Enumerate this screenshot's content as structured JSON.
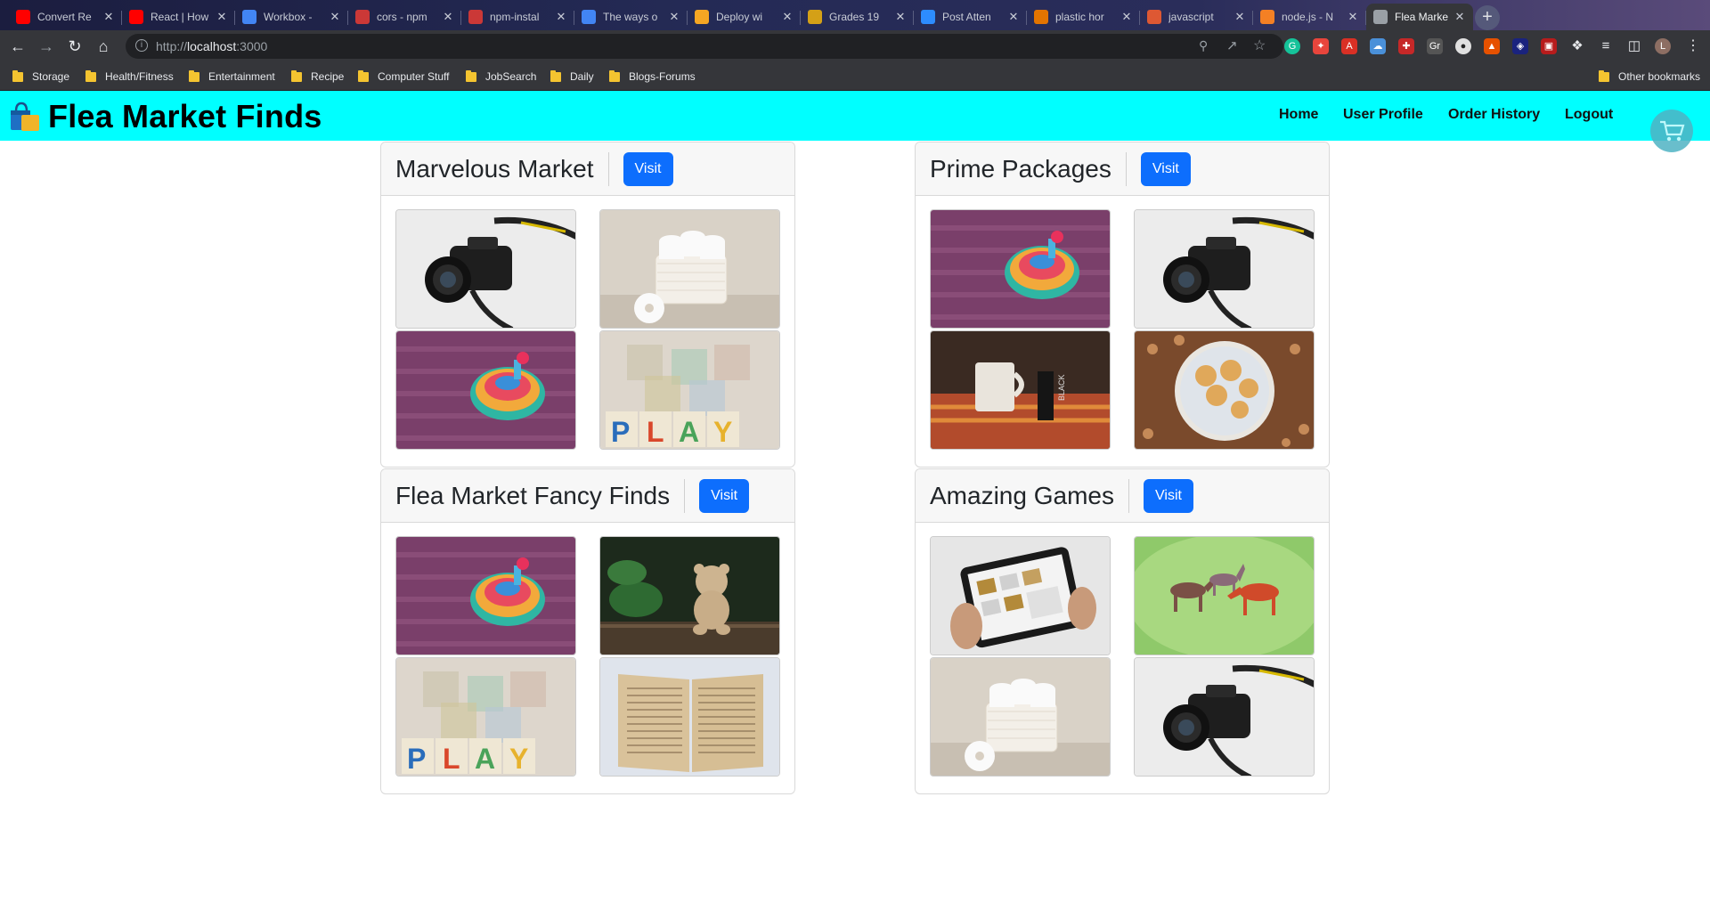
{
  "browser": {
    "tabs": [
      {
        "title": "Convert Re",
        "icon": "youtube-icon",
        "color": "#ff0000"
      },
      {
        "title": "React | How",
        "icon": "youtube-icon",
        "color": "#ff0000"
      },
      {
        "title": "Workbox - ",
        "icon": "chrome-icon",
        "color": "#4285f4"
      },
      {
        "title": "cors - npm",
        "icon": "npm-icon",
        "color": "#cb3837"
      },
      {
        "title": "npm-instal",
        "icon": "npm-icon",
        "color": "#cb3837"
      },
      {
        "title": "The ways o",
        "icon": "chrome-icon",
        "color": "#4285f4"
      },
      {
        "title": "Deploy wi",
        "icon": "deploy-icon",
        "color": "#f5a623"
      },
      {
        "title": "Grades 19",
        "icon": "bee-icon",
        "color": "#d4a017"
      },
      {
        "title": "Post Atten",
        "icon": "zoom-icon",
        "color": "#2d8cff"
      },
      {
        "title": "plastic hor",
        "icon": "chart-icon",
        "color": "#e37400"
      },
      {
        "title": "javascript ",
        "icon": "duck-icon",
        "color": "#de5833"
      },
      {
        "title": "node.js - N",
        "icon": "stack-icon",
        "color": "#f48024"
      },
      {
        "title": "Flea Marke",
        "icon": "globe-icon",
        "color": "#9aa0a6"
      }
    ],
    "url_prefix": "http://",
    "url_host": "localhost",
    "url_port": ":3000",
    "bookmarks": [
      "Storage",
      "Health/Fitness",
      "Entertainment",
      "Recipe",
      "Computer Stuff",
      "JobSearch",
      "Daily",
      "Blogs-Forums"
    ],
    "other_bookmarks": "Other bookmarks",
    "profile_initial": "L"
  },
  "app": {
    "brand": "Flea Market Finds",
    "nav": [
      "Home",
      "User Profile",
      "Order History",
      "Logout"
    ]
  },
  "markets": [
    {
      "name": "Marvelous Market",
      "visit_label": "Visit",
      "images": [
        "camera",
        "toilet-paper",
        "spinning-top",
        "play-blocks"
      ]
    },
    {
      "name": "Prime Packages",
      "visit_label": "Visit",
      "images": [
        "spinning-top",
        "camera",
        "mug-and-box",
        "butter-cookies"
      ]
    },
    {
      "name": "Flea Market Fancy Finds",
      "visit_label": "Visit",
      "images": [
        "spinning-top",
        "teddy-bear",
        "play-blocks",
        "open-book"
      ]
    },
    {
      "name": "Amazing Games",
      "visit_label": "Visit",
      "images": [
        "tablet",
        "toy-horses",
        "toilet-paper",
        "camera"
      ]
    }
  ],
  "colors": {
    "navbar": "#00ffff",
    "visit_button": "#0d6efd",
    "cart": "#4fb3c4"
  }
}
